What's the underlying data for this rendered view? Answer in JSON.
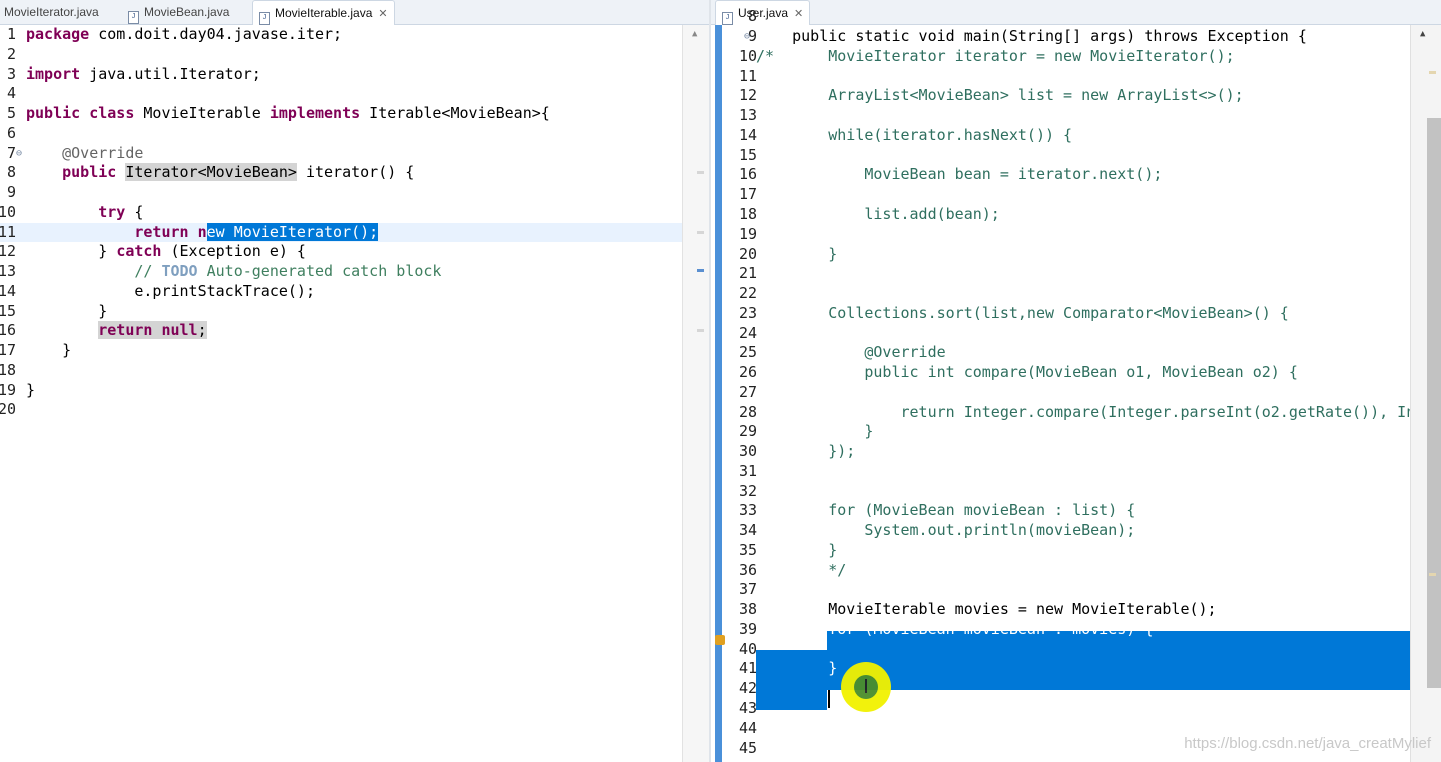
{
  "left_editor": {
    "tabs": [
      {
        "label": "MovieIterator.java",
        "active": false
      },
      {
        "label": "MovieBean.java",
        "active": false
      },
      {
        "label": "MovieIterable.java",
        "active": true
      }
    ],
    "line_numbers": [
      "1",
      "2",
      "3",
      "4",
      "5",
      "6",
      "7",
      "8",
      "9",
      "10",
      "11",
      "12",
      "13",
      "14",
      "15",
      "16",
      "17",
      "18",
      "19",
      "20"
    ],
    "lines": [
      {
        "kw": "package",
        "rest": " com.doit.day04.javase.iter;"
      },
      {},
      {
        "kw": "import",
        "rest": " java.util.Iterator;"
      },
      {},
      {
        "kw1": "public",
        "kw2": "class",
        "mid": " MovieIterable ",
        "kw3": "implements",
        "rest": " Iterable<MovieBean>{"
      },
      {},
      {
        "ann": "    @Override"
      },
      {
        "kw": "    public",
        "hl": "Iterator<MovieBean>",
        "rest": " iterator() {"
      },
      {},
      {
        "kw": "        try",
        "rest": " {"
      },
      {
        "kw": "            return",
        "pre": " n",
        "sel": "ew MovieIterator();"
      },
      {
        "pre": "        } ",
        "kw": "catch",
        "rest": " (Exception e) {"
      },
      {
        "cm1": "            // ",
        "todo": "TODO",
        "cm2": " Auto-generated catch block"
      },
      {
        "rest": "            e.printStackTrace();"
      },
      {
        "rest": "        }"
      },
      {
        "kw": "return null",
        "rest": ";"
      },
      {
        "rest": "    }"
      },
      {},
      {
        "rest": "}"
      },
      {}
    ]
  },
  "right_editor": {
    "tabs": [
      {
        "label": "User.java",
        "active": true
      }
    ],
    "line_numbers": [
      "8",
      "9",
      "10",
      "11",
      "12",
      "13",
      "14",
      "15",
      "16",
      "17",
      "18",
      "19",
      "20",
      "21",
      "22",
      "23",
      "24",
      "25",
      "26",
      "27",
      "28",
      "29",
      "30",
      "31",
      "32",
      "33",
      "34",
      "35",
      "36",
      "37",
      "38",
      "39",
      "40",
      "41",
      "42",
      "43",
      "44",
      "45"
    ],
    "lines": [
      "",
      "    public static void main(String[] args) throws Exception {",
      "/*      MovieIterator iterator = new MovieIterator();",
      "",
      "        ArrayList<MovieBean> list = new ArrayList<>();",
      "",
      "        while(iterator.hasNext()) {",
      "",
      "            MovieBean bean = iterator.next();",
      "",
      "            list.add(bean);",
      "",
      "        }",
      "",
      "",
      "        Collections.sort(list,new Comparator<MovieBean>() {",
      "",
      "            @Override",
      "            public int compare(MovieBean o1, MovieBean o2) {",
      "",
      "                return Integer.compare(Integer.parseInt(o2.getRate()), In",
      "            }",
      "        });",
      "",
      "",
      "        for (MovieBean movieBean : list) {",
      "            System.out.println(movieBean);",
      "        }",
      "        */",
      "",
      "        MovieIterable movies = new MovieIterable();",
      "        for (MovieBean movieBean : movies) {",
      "",
      "        }",
      "",
      "",
      "",
      ""
    ]
  },
  "watermark": "https://blog.csdn.net/java_creatMylief",
  "colors": {
    "keyword": "#7f0055",
    "comment": "#3f7f5f",
    "selection": "#0078d7",
    "annotation": "#646464"
  }
}
